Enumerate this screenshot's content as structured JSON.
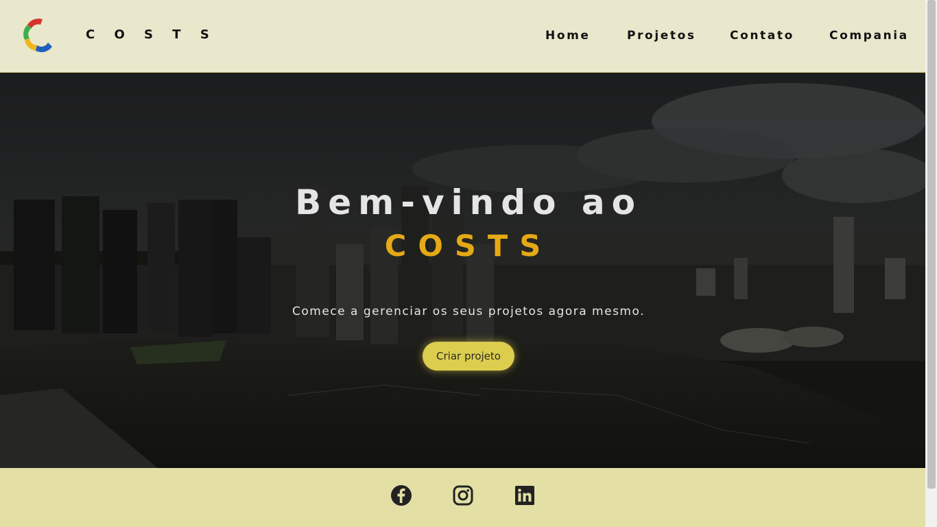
{
  "navbar": {
    "brand": "C O S T S",
    "items": [
      {
        "label": "Home"
      },
      {
        "label": "Projetos"
      },
      {
        "label": "Contato"
      },
      {
        "label": "Compania"
      }
    ]
  },
  "hero": {
    "title": "Bem-vindo ao",
    "brand": "COSTS",
    "subtitle": "Comece a gerenciar os seus projetos agora mesmo.",
    "cta_label": "Criar projeto"
  },
  "footer": {
    "icons": [
      "facebook-icon",
      "instagram-icon",
      "linkedin-icon"
    ]
  },
  "colors": {
    "navbar_bg": "#e9e7cc",
    "footer_bg": "#e3dfa5",
    "accent_brand": "#e5a917",
    "cta_bg": "#dccd4f"
  }
}
